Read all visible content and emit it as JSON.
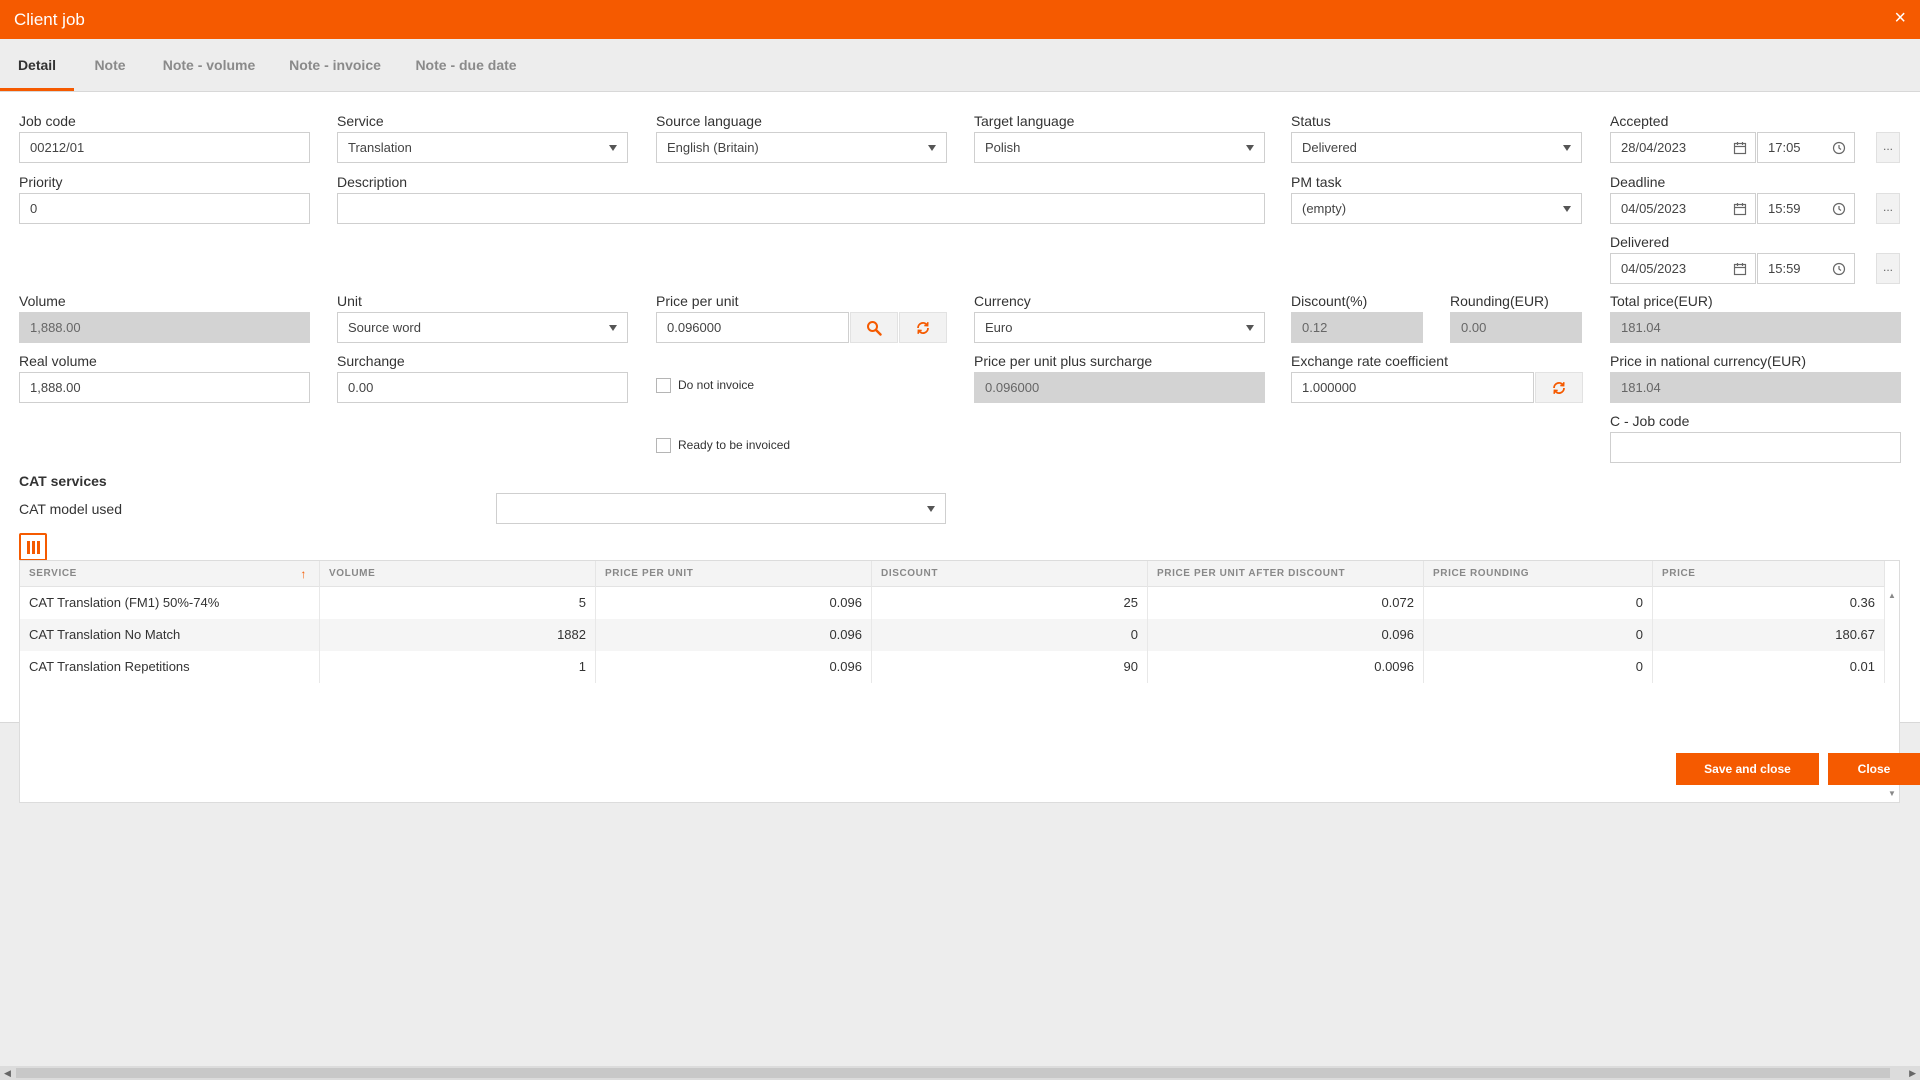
{
  "window": {
    "title": "Client job",
    "close_icon": "×"
  },
  "tabs": [
    {
      "label": "Detail",
      "active": true
    },
    {
      "label": "Note"
    },
    {
      "label": "Note - volume"
    },
    {
      "label": "Note - invoice"
    },
    {
      "label": "Note - due date"
    }
  ],
  "form": {
    "job_code": {
      "label": "Job code",
      "value": "00212/01"
    },
    "service": {
      "label": "Service",
      "value": "Translation"
    },
    "source_language": {
      "label": "Source language",
      "value": "English (Britain)"
    },
    "target_language": {
      "label": "Target language",
      "value": "Polish"
    },
    "status": {
      "label": "Status",
      "value": "Delivered"
    },
    "accepted": {
      "label": "Accepted",
      "date": "28/04/2023",
      "time": "17:05"
    },
    "priority": {
      "label": "Priority",
      "value": "0"
    },
    "description": {
      "label": "Description",
      "value": ""
    },
    "pm_task": {
      "label": "PM task",
      "value": "(empty)"
    },
    "deadline": {
      "label": "Deadline",
      "date": "04/05/2023",
      "time": "15:59"
    },
    "delivered": {
      "label": "Delivered",
      "date": "04/05/2023",
      "time": "15:59"
    },
    "volume": {
      "label": "Volume",
      "value": "1,888.00"
    },
    "unit": {
      "label": "Unit",
      "value": "Source word"
    },
    "price_per_unit": {
      "label": "Price per unit",
      "value": "0.096000"
    },
    "currency": {
      "label": "Currency",
      "value": "Euro"
    },
    "discount": {
      "label": "Discount(%)",
      "value": "0.12"
    },
    "rounding": {
      "label": "Rounding(EUR)",
      "value": "0.00"
    },
    "total_price": {
      "label": "Total price(EUR)",
      "value": "181.04"
    },
    "real_volume": {
      "label": "Real volume",
      "value": "1,888.00"
    },
    "surcharge": {
      "label": "Surchange",
      "value": "0.00"
    },
    "do_not_invoice": {
      "label": "Do not invoice",
      "checked": false
    },
    "price_plus_surcharge": {
      "label": "Price per unit plus surcharge",
      "value": "0.096000"
    },
    "exchange_rate": {
      "label": "Exchange rate coefficient",
      "value": "1.000000"
    },
    "price_national": {
      "label": "Price in national currency(EUR)",
      "value": "181.04"
    },
    "ready_to_invoice": {
      "label": "Ready to be invoiced",
      "checked": false
    },
    "c_job_code": {
      "label": "C - Job code",
      "value": ""
    },
    "ellipsis": "..."
  },
  "cat": {
    "section_title": "CAT services",
    "model_label": "CAT model used",
    "model_value": "",
    "columns": [
      "SERVICE",
      "VOLUME",
      "PRICE PER UNIT",
      "DISCOUNT",
      "PRICE PER UNIT AFTER DISCOUNT",
      "PRICE ROUNDING",
      "PRICE"
    ],
    "sort_indicator": "↑",
    "rows": [
      [
        "CAT Translation (FM1) 50%-74%",
        "5",
        "0.096",
        "25",
        "0.072",
        "0",
        "0.36"
      ],
      [
        "CAT Translation No Match",
        "1882",
        "0.096",
        "0",
        "0.096",
        "0",
        "180.67"
      ],
      [
        "CAT Translation Repetitions",
        "1",
        "0.096",
        "90",
        "0.0096",
        "0",
        "0.01"
      ]
    ]
  },
  "actions": {
    "save_close": "Save and close",
    "close": "Close"
  },
  "colors": {
    "accent": "#f55a00",
    "readonly": "#d3d3d3"
  }
}
